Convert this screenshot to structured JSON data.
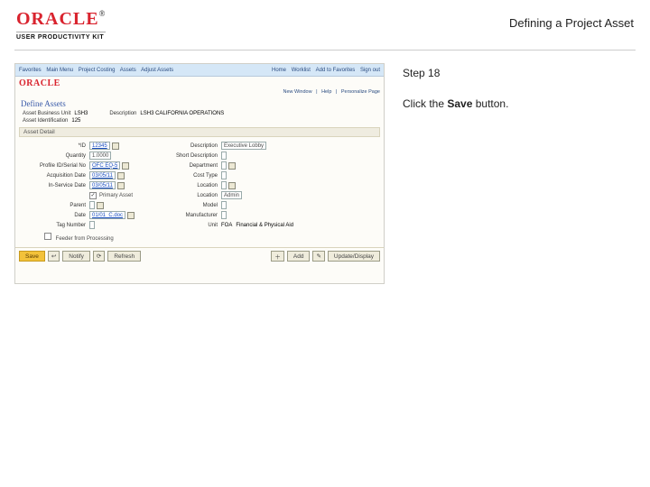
{
  "header": {
    "brand_main": "ORACLE",
    "brand_sub": "USER PRODUCTIVITY KIT",
    "doc_title": "Defining a Project Asset"
  },
  "instructions": {
    "step_label": "Step 18",
    "text_before": "Click the ",
    "text_bold": "Save",
    "text_after": " button."
  },
  "app": {
    "topbar": {
      "crumbs": [
        "Favorites",
        "Main Menu",
        "Project Costing",
        "Assets",
        "Adjust Assets"
      ],
      "right": [
        "Home",
        "Worklist",
        "Add to Favorites",
        "Sign out"
      ]
    },
    "brand": "ORACLE",
    "subnav": [
      "New Window",
      "Help",
      "Personalize Page"
    ],
    "page_title": "Define Assets",
    "info": {
      "bu_label": "Asset Business Unit",
      "bu_value": "LSH3",
      "desc_label": "Description",
      "desc_value": "LSH3 CALIFORNIA OPERATIONS",
      "aid_label": "Asset Identification",
      "aid_value": "125"
    },
    "section_band": "Asset Detail",
    "form": {
      "id_label": "*ID",
      "id_value": "12345",
      "quantity_label": "Quantity",
      "quantity_value": "1.0000",
      "prof_label": "Profile ID/Serial No",
      "prof_value": "OFC EQ-5",
      "acq_label": "Acquisition Date",
      "acq_value": "03/05/11",
      "svc_label": "In-Service Date",
      "svc_value": "03/05/11",
      "powner_label": "",
      "powner_chk": "✓",
      "powner_text": "Primary Asset",
      "parent_label": "Parent",
      "parent_value": "",
      "date_label": "Date",
      "date_value": "01/01_C.doc",
      "tag_label": "Tag Number",
      "tag_value": "",
      "desc2_label": "Description",
      "desc2_value": "Executive Lobby",
      "sdesc_label": "Short Description",
      "sdesc_value": "",
      "dept_label": "Department",
      "dept_value": "",
      "cost_label": "Cost Type",
      "cost_value": "",
      "loc_label": "Location",
      "loc_value": "",
      "loc2_label": "Location",
      "loc2_value": "Admin",
      "model_label": "Model",
      "model_value": "",
      "manu_label": "Manufacturer",
      "manu_value": "",
      "unit_label": "Unit",
      "unit_value": "FOA",
      "unit_desc": "Financial & Physical Aid"
    },
    "extra_check": "Feeder from Processing",
    "bottombar": {
      "save": "Save",
      "notify": "Notify",
      "refresh": "Refresh",
      "add": "Add",
      "update": "Update/Display"
    }
  }
}
